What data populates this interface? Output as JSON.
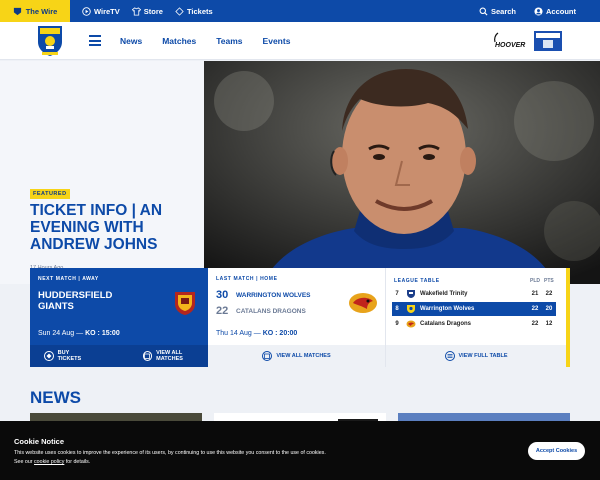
{
  "topbar": {
    "wire_label": "The Wire",
    "links": [
      {
        "label": "WireTV",
        "icon": "play-icon"
      },
      {
        "label": "Store",
        "icon": "shirt-icon"
      },
      {
        "label": "Tickets",
        "icon": "ticket-icon"
      }
    ],
    "search_label": "Search",
    "account_label": "Account"
  },
  "nav": {
    "items": [
      "News",
      "Matches",
      "Teams",
      "Events"
    ]
  },
  "hero": {
    "badge": "FEATURED",
    "title": "TICKET INFO | AN EVENING WITH ANDREW JOHNS",
    "time": "17 Hours Ago"
  },
  "next_match": {
    "label": "NEXT MATCH | AWAY",
    "opponent": "HUDDERSFIELD GIANTS",
    "date": "Sun 24 Aug — ",
    "ko_label": "KO : 15:00",
    "buy_tickets": "BUY TICKETS",
    "view_all": "VIEW ALL MATCHES"
  },
  "last_match": {
    "label": "LAST MATCH | HOME",
    "home_score": "30",
    "home_team": "WARRINGTON WOLVES",
    "away_score": "22",
    "away_team": "CATALANS DRAGONS",
    "date": "Thu 14 Aug — ",
    "ko_label": "KO : 20:00",
    "view_all": "VIEW ALL MATCHES"
  },
  "league_table": {
    "label": "LEAGUE TABLE",
    "col_pld": "PLD",
    "col_pts": "PTS",
    "rows": [
      {
        "pos": "7",
        "team": "Wakefield Trinity",
        "pld": "21",
        "pts": "22"
      },
      {
        "pos": "8",
        "team": "Warrington Wolves",
        "pld": "22",
        "pts": "20"
      },
      {
        "pos": "9",
        "team": "Catalans Dragons",
        "pld": "22",
        "pts": "12"
      }
    ],
    "view_full": "VIEW FULL TABLE"
  },
  "news": {
    "heading": "NEWS"
  },
  "cookie": {
    "title": "Cookie Notice",
    "text_line1": "This website uses cookies to improve the experience of its users, by continuing to use this website you consent to the use of cookies.",
    "text_see": "See our ",
    "text_link": "cookie policy",
    "text_after": " for details.",
    "accept": "Accept Cookies"
  },
  "colors": {
    "primary_blue": "#0d4aa8",
    "accent_yellow": "#f7d417",
    "cookie_bg": "#0a0a0a"
  }
}
